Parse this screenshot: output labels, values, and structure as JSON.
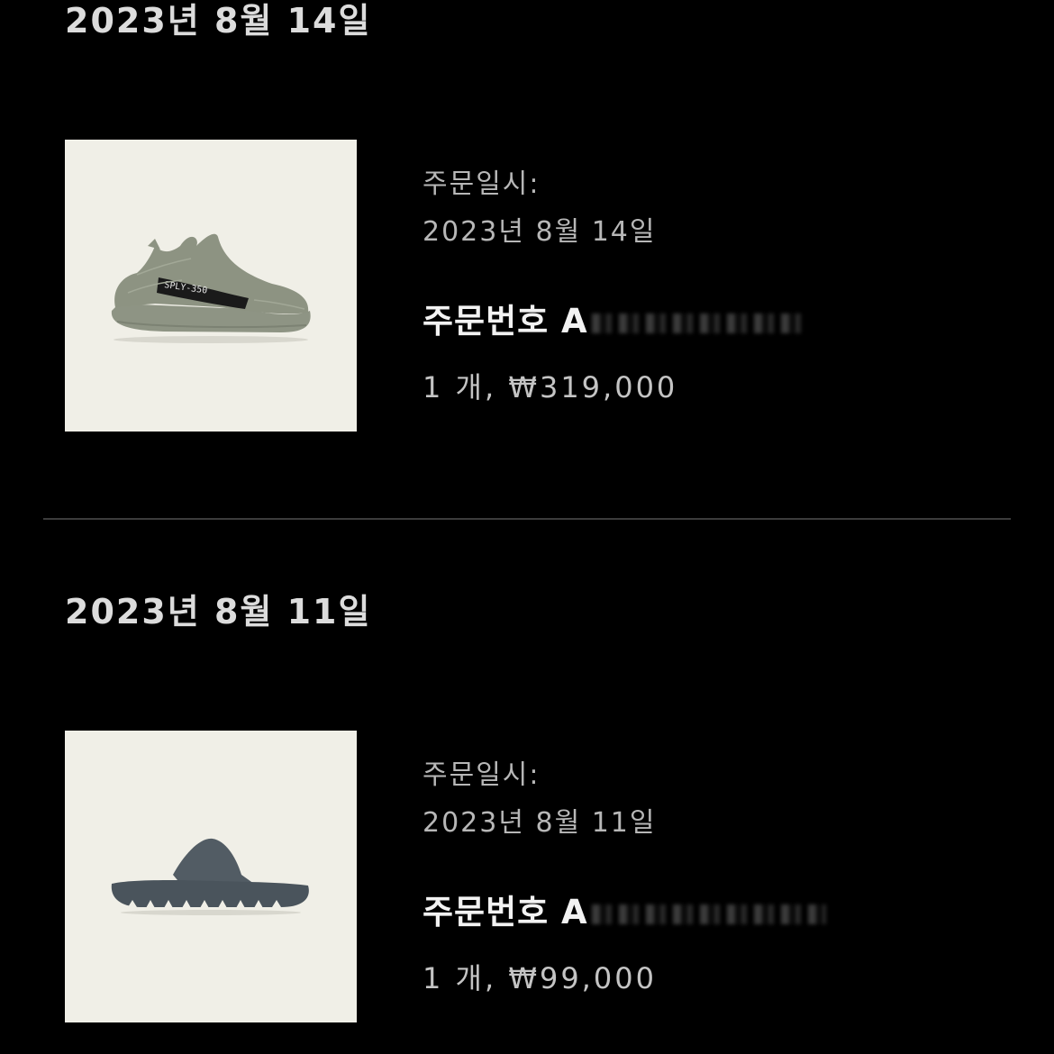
{
  "orders": [
    {
      "group_date": "2023년 8월 14일",
      "thumbnail_icon": "sneaker-image",
      "sneaker_print": "SPLY-350",
      "order_time_label": "주문일시:",
      "order_time_value": "2023년 8월 14일",
      "order_number_label": "주문번호 A",
      "quantity_price": "1 개, ₩319,000"
    },
    {
      "group_date": "2023년 8월 11일",
      "thumbnail_icon": "slide-sandal-image",
      "order_time_label": "주문일시:",
      "order_time_value": "2023년 8월 11일",
      "order_number_label": "주문번호 A",
      "quantity_price": "1 개, ₩99,000"
    }
  ],
  "colors": {
    "background": "#000000",
    "thumbnail_bg": "#f0efe7",
    "divider": "#3c3c3c",
    "primary_text": "#f2f2f2",
    "secondary_text": "#b7b7b7"
  }
}
